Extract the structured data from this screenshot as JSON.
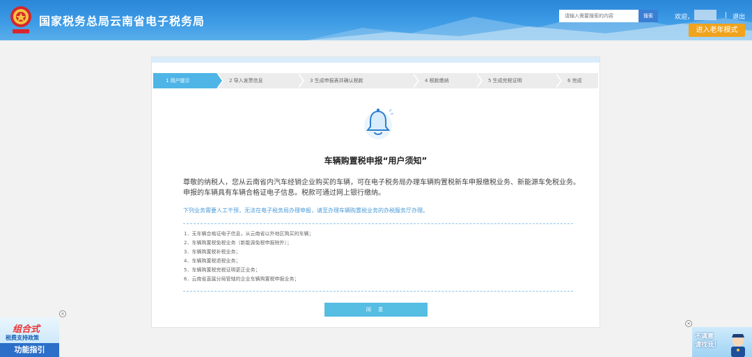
{
  "header": {
    "site_title": "国家税务总局云南省电子税务局",
    "search_placeholder": "请输入需要搜索的内容",
    "search_button": "搜索",
    "welcome": "欢迎，",
    "separator": "|",
    "logout": "退出",
    "elder_mode": "进入老年模式"
  },
  "steps": [
    {
      "label": "1 用户提示",
      "active": true
    },
    {
      "label": "2 导入发票信息",
      "active": false
    },
    {
      "label": "3 生成申报表并确认税款",
      "active": false
    },
    {
      "label": "4 税款缴纳",
      "active": false
    },
    {
      "label": "5 生成完税证明",
      "active": false
    },
    {
      "label": "6 完成",
      "active": false
    }
  ],
  "notice": {
    "title": "车辆购置税申报“用户须知”",
    "intro": "尊敬的纳税人，您从云南省内汽车经销企业购买的车辆，可在电子税务局办理车辆购置税新车申报缴税业务、新能源车免税业务。申报的车辆具有车辆合格证电子信息。税款可通过网上银行缴纳。",
    "blue_note": "下列业务需要人工干预，无法在电子税务局办理申报，请至办理车辆购置税业务的办税服务厅办理。",
    "items": [
      "1．无车辆合格证电子信息，从云南省以外地区购买的车辆；",
      "2．车辆购置税免税业务（新能源免税申报除外）；",
      "3．车辆购置税补税业务；",
      "4．车辆购置税退税业务；",
      "5．车辆购置税完税证明更正业务；",
      "6．云南省直属分局管辖的企业车辆购置税申报业务；"
    ],
    "agree_button": "同 意"
  },
  "ads": {
    "left_line1": "组合式",
    "left_line2": "税费支持政策",
    "left_line3": "功能指引",
    "right_line1": "不满意",
    "right_line2": "请找我！",
    "close": "×"
  },
  "colors": {
    "header_blue": "#3d9be6",
    "step_active": "#4eb5e6",
    "agree_button": "#56bde3",
    "elder_button": "#f0a31c",
    "note_blue": "#4a9ad8"
  },
  "icons": {
    "emblem": "tax-emblem-icon",
    "bell": "bell-icon",
    "close": "close-icon"
  }
}
